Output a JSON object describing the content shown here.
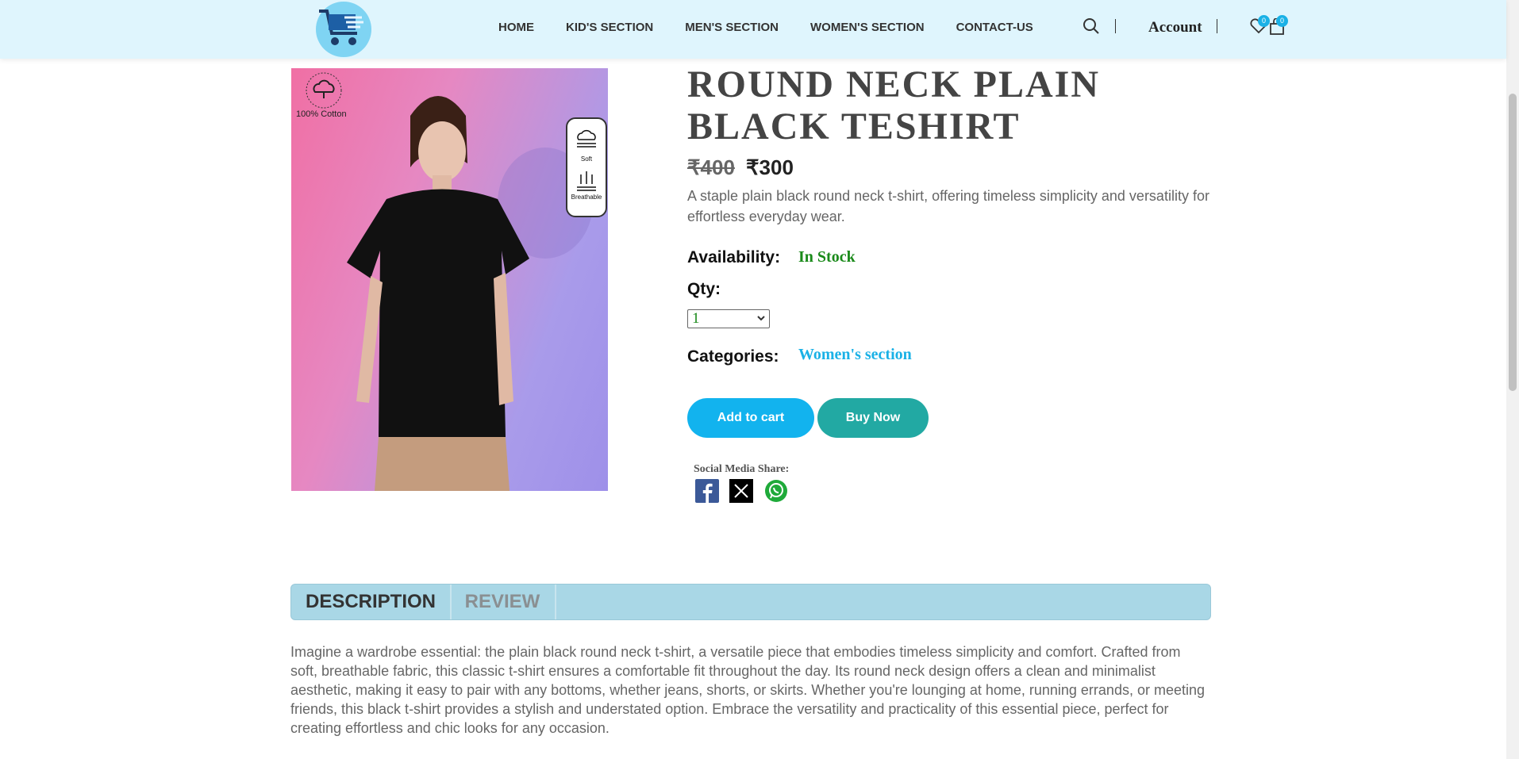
{
  "header": {
    "nav": [
      "HOME",
      "KID'S SECTION",
      "MEN'S SECTION",
      "WOMEN'S SECTION",
      "CONTACT-US"
    ],
    "account_label": "Account",
    "wishlist_count": "0",
    "cart_count": "0"
  },
  "product": {
    "image_badge": "100% Cotton",
    "image_features": [
      "Soft",
      "Breathable"
    ],
    "title": "ROUND NECK PLAIN BLACK TESHIRT",
    "old_price": "₹400",
    "new_price": "₹300",
    "short_description": "A staple plain black round neck t-shirt, offering timeless simplicity and versatility for effortless everyday wear.",
    "availability_label": "Availability:",
    "availability_value": "In Stock",
    "qty_label": "Qty:",
    "qty_value": "1",
    "categories_label": "Categories:",
    "category": "Women's section",
    "add_to_cart": "Add to cart",
    "buy_now": "Buy Now",
    "share_label": "Social Media Share:"
  },
  "tabs": [
    "DESCRIPTION",
    "REVIEW"
  ],
  "description": "Imagine a wardrobe essential: the plain black round neck t-shirt, a versatile piece that embodies timeless simplicity and comfort. Crafted from soft, breathable fabric, this classic t-shirt ensures a comfortable fit throughout the day. Its round neck design offers a clean and minimalist aesthetic, making it easy to pair with any bottoms, whether jeans, shorts, or skirts. Whether you're lounging at home, running errands, or meeting friends, this black t-shirt provides a stylish and understated option. Embrace the versatility and practicality of this essential piece, perfect for creating effortless and chic looks for any occasion.",
  "colors": {
    "header_bg": "#dff5fd",
    "accent": "#12b3ee",
    "buy_button": "#22a9a3",
    "in_stock": "#1a8a1a",
    "tab_bar": "#a9d7e6"
  },
  "icons": [
    "cart-logo-icon",
    "search-icon",
    "heart-icon",
    "shopping-bag-icon",
    "facebook-icon",
    "x-twitter-icon",
    "whatsapp-icon",
    "chevron-down-icon"
  ]
}
